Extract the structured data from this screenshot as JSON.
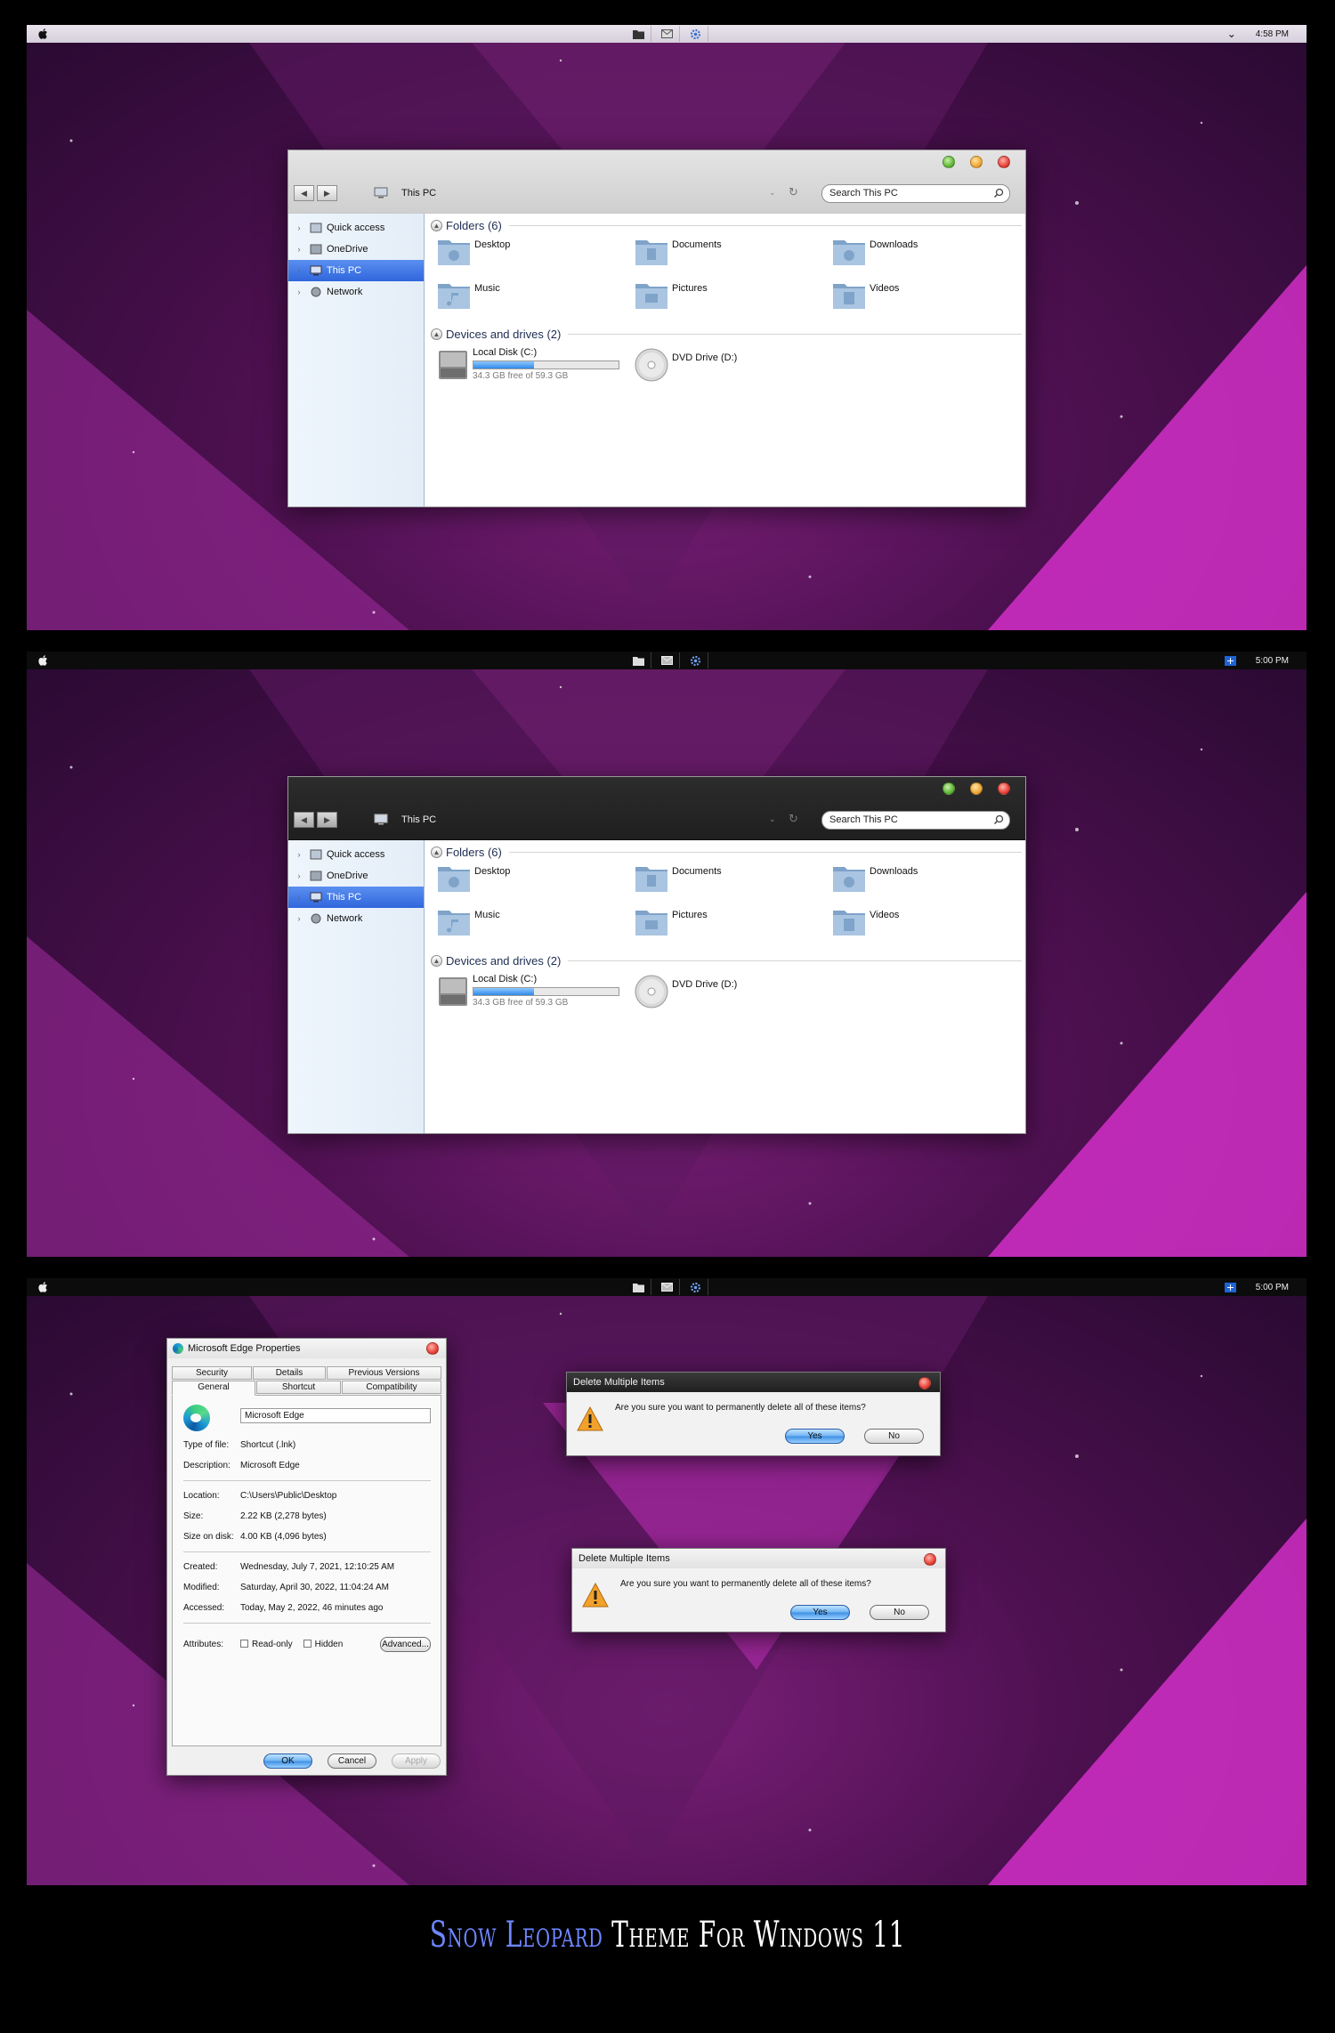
{
  "screens": [
    {
      "theme": "light",
      "menubar": {
        "clock": "4:58 PM",
        "tray_right_icon": "chevron-down-icon"
      },
      "explorer": {
        "address": "This PC",
        "search_placeholder": "Search This PC",
        "nav": [
          "Quick access",
          "OneDrive",
          "This PC",
          "Network"
        ],
        "selected_nav": "This PC",
        "folders_header": "Folders (6)",
        "folders": [
          "Desktop",
          "Documents",
          "Downloads",
          "Music",
          "Pictures",
          "Videos"
        ],
        "drives_header": "Devices and drives (2)",
        "drives": [
          {
            "name": "Local Disk (C:)",
            "free": "34.3 GB free of 59.3 GB",
            "used_fraction": 0.42
          },
          {
            "name": "DVD Drive (D:)"
          }
        ]
      }
    },
    {
      "theme": "dark",
      "menubar": {
        "clock": "5:00 PM",
        "tray_right_icon": "notification-flag-icon"
      },
      "explorer": {
        "address": "This PC",
        "search_placeholder": "Search This PC",
        "nav": [
          "Quick access",
          "OneDrive",
          "This PC",
          "Network"
        ],
        "selected_nav": "This PC",
        "folders_header": "Folders (6)",
        "folders": [
          "Desktop",
          "Documents",
          "Downloads",
          "Music",
          "Pictures",
          "Videos"
        ],
        "drives_header": "Devices and drives (2)",
        "drives": [
          {
            "name": "Local Disk (C:)",
            "free": "34.3 GB free of 59.3 GB",
            "used_fraction": 0.42
          },
          {
            "name": "DVD Drive (D:)"
          }
        ]
      }
    },
    {
      "theme": "dark",
      "menubar": {
        "clock": "5:00 PM",
        "tray_right_icon": "notification-flag-icon"
      },
      "properties": {
        "title": "Microsoft Edge Properties",
        "tabs_row1": [
          "Security",
          "Details",
          "Previous Versions"
        ],
        "tabs_row2": [
          "General",
          "Shortcut",
          "Compatibility"
        ],
        "selected_tab": "General",
        "name": "Microsoft Edge",
        "rows": [
          {
            "label": "Type of file:",
            "value": "Shortcut (.lnk)"
          },
          {
            "label": "Description:",
            "value": "Microsoft Edge"
          },
          {
            "label": "Location:",
            "value": "C:\\Users\\Public\\Desktop"
          },
          {
            "label": "Size:",
            "value": "2.22 KB (2,278 bytes)"
          },
          {
            "label": "Size on disk:",
            "value": "4.00 KB (4,096 bytes)"
          },
          {
            "label": "Created:",
            "value": "Wednesday, July 7, 2021, 12:10:25 AM"
          },
          {
            "label": "Modified:",
            "value": "Saturday, April 30, 2022, 11:04:24 AM"
          },
          {
            "label": "Accessed:",
            "value": "Today, May 2, 2022, 46 minutes ago"
          }
        ],
        "attributes_label": "Attributes:",
        "readonly_label": "Read-only",
        "hidden_label": "Hidden",
        "advanced_label": "Advanced...",
        "ok_label": "OK",
        "cancel_label": "Cancel",
        "apply_label": "Apply"
      },
      "delete_dialogs": [
        {
          "title": "Delete Multiple Items",
          "message": "Are you sure you want to permanently delete all of these items?",
          "yes": "Yes",
          "no": "No",
          "style": "dark"
        },
        {
          "title": "Delete Multiple Items",
          "message": "Are you sure you want to permanently delete all of these items?",
          "yes": "Yes",
          "no": "No",
          "style": "light"
        }
      ]
    }
  ],
  "caption": {
    "part1": "Snow Leopard",
    "part2": "Theme For Windows 11"
  },
  "colors": {
    "accent_blue": "#2f66dc",
    "caption_blue": "#6e86ff",
    "wallpaper": "#4d1050"
  }
}
